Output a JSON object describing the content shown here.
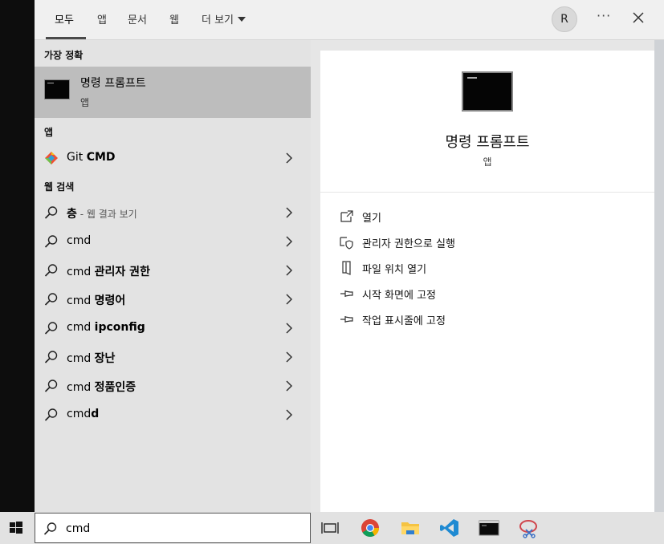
{
  "tabs": [
    {
      "label": "모두"
    },
    {
      "label": "앱"
    },
    {
      "label": "문서"
    },
    {
      "label": "웹"
    }
  ],
  "more_label": "더 보기",
  "avatar_letter": "R",
  "more_dots": "···",
  "left": {
    "best_match_header": "가장 정확",
    "best": {
      "title": "명령 프롬프트",
      "subtitle": "앱"
    },
    "apps_header": "앱",
    "app_item": {
      "prefix": "Git ",
      "bold": "CMD"
    },
    "web_header": "웹 검색",
    "web_items": [
      {
        "prefix": "",
        "bold": "층",
        "hint": " - 웹 결과 보기"
      },
      {
        "prefix": "cmd",
        "bold": "",
        "hint": ""
      },
      {
        "prefix": "cmd ",
        "bold": "관리자 권한",
        "hint": ""
      },
      {
        "prefix": "cmd ",
        "bold": "명령어",
        "hint": ""
      },
      {
        "prefix": "cmd ",
        "bold": "ipconfig",
        "hint": ""
      },
      {
        "prefix": "cmd ",
        "bold": "장난",
        "hint": ""
      },
      {
        "prefix": "cmd ",
        "bold": "정품인증",
        "hint": ""
      },
      {
        "prefix": "cmd",
        "bold": "d",
        "hint": ""
      }
    ]
  },
  "right": {
    "title": "명령 프롬프트",
    "subtitle": "앱",
    "actions": [
      {
        "label": "열기",
        "icon": "open-icon"
      },
      {
        "label": "관리자 권한으로 실행",
        "icon": "shield-icon"
      },
      {
        "label": "파일 위치 열기",
        "icon": "file-location-icon"
      },
      {
        "label": "시작 화면에 고정",
        "icon": "pin-icon"
      },
      {
        "label": "작업 표시줄에 고정",
        "icon": "pin-icon"
      }
    ]
  },
  "search": {
    "value": "cmd"
  },
  "taskbar_icons": [
    "task-view-icon",
    "chrome-icon",
    "file-explorer-icon",
    "vscode-icon",
    "terminal-icon",
    "snipping-tool-icon"
  ]
}
